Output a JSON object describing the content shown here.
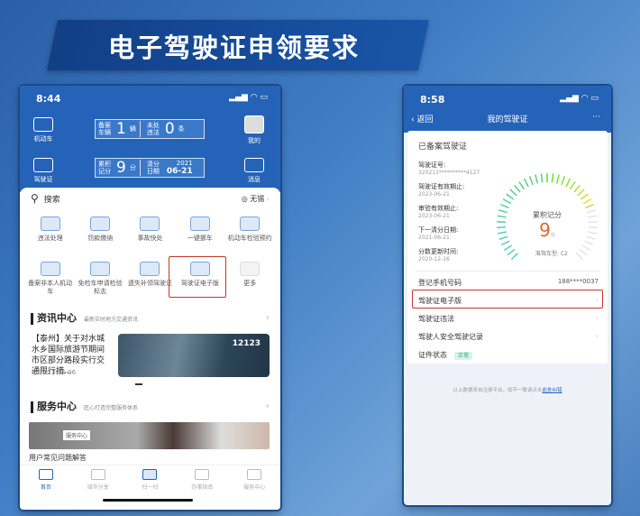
{
  "title": "电子驾驶证申领要求",
  "left": {
    "status": {
      "time": "8:44"
    },
    "header": {
      "vehicle_label": "机动车",
      "license_label": "驾驶证",
      "mine_label": "我的",
      "message_label": "消息",
      "box1": {
        "a_label": "备案车辆",
        "a_value": "1",
        "a_unit": "辆",
        "b_label": "未处违法",
        "b_value": "0",
        "b_unit": "条"
      },
      "box2": {
        "a_label": "累积记分",
        "a_value": "9",
        "a_unit": "分",
        "b_label": "清分日期",
        "b_year": "2021",
        "b_date": "06-21"
      }
    },
    "search": {
      "placeholder": "搜索",
      "city": "无锡"
    },
    "grid_row1": [
      "违法处理",
      "罚款缴纳",
      "事故快处",
      "一键挪车",
      "机动车检验预约"
    ],
    "grid_row2": [
      "备案非本人机动车",
      "免检车申请检验标志",
      "遗失补领驾驶证",
      "驾驶证电子版",
      "更多"
    ],
    "news": {
      "title": "资讯中心",
      "subtitle": "最新实时地方交通资讯",
      "headline": "【泰州】关于对水城水乡国际旅游节期间市区部分路段实行交通限行措...",
      "date": "2021-04-06",
      "image_text": "12123"
    },
    "service": {
      "title": "服务中心",
      "subtitle": "匠心打造完整服务体系",
      "banner_tag": "服务中心",
      "faq": "用户常见问题解答"
    },
    "tabs": [
      "首页",
      "城市分享",
      "扫一扫",
      "办事指南",
      "服务中心"
    ]
  },
  "right": {
    "status": {
      "time": "8:58"
    },
    "nav": {
      "back": "返回",
      "title": "我的驾驶证",
      "more": "···"
    },
    "card_title": "已备案驾驶证",
    "fields": [
      {
        "k": "驾驶证号:",
        "v": "320211**********4127"
      },
      {
        "k": "驾驶证有效期止:",
        "v": "2023-06-21"
      },
      {
        "k": "审验有效期止:",
        "v": "2023-06-21"
      },
      {
        "k": "下一清分日期:",
        "v": "2021-06-21"
      },
      {
        "k": "分数更新时间:",
        "v": "2020-12-16"
      }
    ],
    "gauge": {
      "label": "累积记分",
      "value": "9",
      "unit": "分",
      "max": 12,
      "class_label": "准驾车型: C2"
    },
    "phone": {
      "label": "登记手机号码",
      "value": "188****0037"
    },
    "rows": [
      "驾驶证电子版",
      "驾驶证违法",
      "驾驶人安全驾驶记录"
    ],
    "status_row": {
      "label": "证件状态",
      "badge": "正常"
    },
    "footer": {
      "text": "以上数据来自注册平台，如不一致请点击",
      "link": "此处纠错"
    }
  }
}
